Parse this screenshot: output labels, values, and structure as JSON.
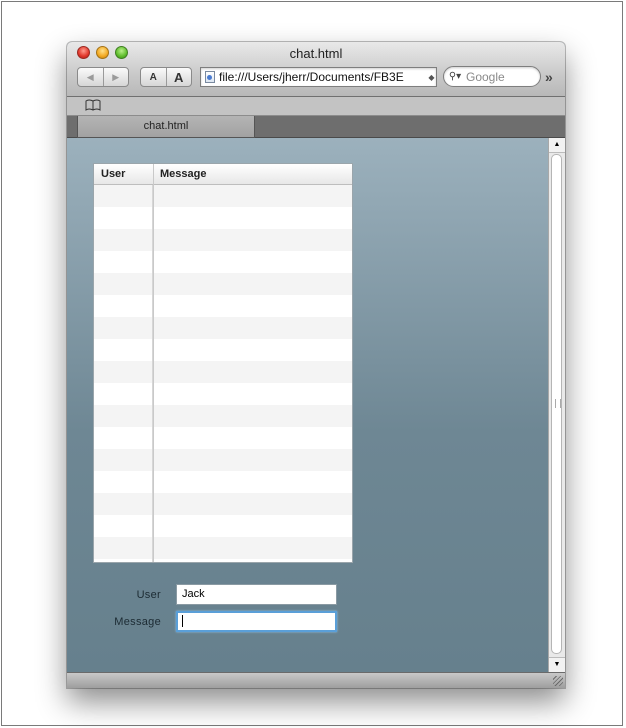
{
  "window": {
    "title": "chat.html",
    "address": "file:///Users/jherr/Documents/FB3E",
    "search_placeholder": "Google",
    "tab_label": "chat.html"
  },
  "icons": {
    "back": "back-arrow-icon",
    "forward": "forward-arrow-icon",
    "bookmarks": "book-icon",
    "search": "magnifier-icon",
    "page": "document-icon",
    "overflow": "double-chevron-icon"
  },
  "toolbar": {
    "text_smaller": "A",
    "text_larger": "A",
    "overflow": "»"
  },
  "grid": {
    "columns": [
      "User",
      "Message"
    ],
    "rows": [
      {
        "user": "",
        "message": ""
      },
      {
        "user": "",
        "message": ""
      },
      {
        "user": "",
        "message": ""
      },
      {
        "user": "",
        "message": ""
      },
      {
        "user": "",
        "message": ""
      },
      {
        "user": "",
        "message": ""
      },
      {
        "user": "",
        "message": ""
      },
      {
        "user": "",
        "message": ""
      },
      {
        "user": "",
        "message": ""
      },
      {
        "user": "",
        "message": ""
      },
      {
        "user": "",
        "message": ""
      },
      {
        "user": "",
        "message": ""
      },
      {
        "user": "",
        "message": ""
      },
      {
        "user": "",
        "message": ""
      },
      {
        "user": "",
        "message": ""
      },
      {
        "user": "",
        "message": ""
      },
      {
        "user": "",
        "message": ""
      },
      {
        "user": "",
        "message": ""
      }
    ]
  },
  "form": {
    "user_label": "User",
    "user_value": "Jack",
    "message_label": "Message",
    "message_value": ""
  },
  "colors": {
    "content_top": "#9cb1bd",
    "content_bottom": "#66808d",
    "focus_ring": "#5a9fd8"
  }
}
